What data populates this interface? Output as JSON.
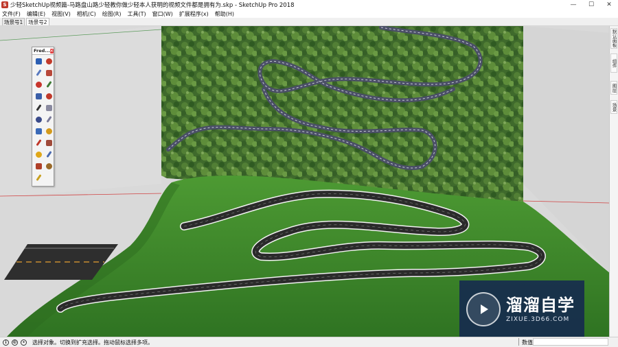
{
  "window": {
    "title": "少轻SketchUp视频篇-马路盘山路少轻教你做少轻本人获明的视频文件都是拥有为.skp - SketchUp Pro 2018",
    "app_icon": "sketchup-logo-icon",
    "controls": {
      "minimize": "—",
      "maximize": "☐",
      "close": "✕"
    }
  },
  "menu": [
    "文件(F)",
    "编辑(E)",
    "视图(V)",
    "相机(C)",
    "绘图(R)",
    "工具(T)",
    "窗口(W)",
    "扩展程序(x)",
    "帮助(H)"
  ],
  "scenes": [
    "场景号1",
    "场景号2"
  ],
  "active_scene": 1,
  "palette": {
    "title": "Fred...",
    "close": "✕",
    "tools": [
      {
        "icon": "wave-tool-icon",
        "color": "#2c5fb3"
      },
      {
        "icon": "cone-tool-icon",
        "color": "#c23a2a"
      },
      {
        "icon": "cube-tool-icon",
        "color": "#5a7abf"
      },
      {
        "icon": "prism-tool-icon",
        "color": "#b8483a"
      },
      {
        "icon": "box-red-tool-icon",
        "color": "#c8362e"
      },
      {
        "icon": "tree-tool-icon",
        "color": "#3d7a35"
      },
      {
        "icon": "split-tool-icon",
        "color": "#3b5fa8"
      },
      {
        "icon": "line-tool-icon",
        "color": "#c0392b"
      },
      {
        "icon": "pen-tool-icon",
        "color": "#333333"
      },
      {
        "icon": "fold-tool-icon",
        "color": "#8a8aa0"
      },
      {
        "icon": "bars-tool-icon",
        "color": "#3a4a8a"
      },
      {
        "icon": "swirl-tool-icon",
        "color": "#7a7a9a"
      },
      {
        "icon": "arrow-tool-icon",
        "color": "#3a6ab8"
      },
      {
        "icon": "star-tool-icon",
        "color": "#d49a1c"
      },
      {
        "icon": "slash-tool-icon",
        "color": "#c0392b"
      },
      {
        "icon": "grid-tool-icon",
        "color": "#a04a3a"
      },
      {
        "icon": "bolt-tool-icon",
        "color": "#e0a81a"
      },
      {
        "icon": "wand-tool-icon",
        "color": "#4a6ab0"
      },
      {
        "icon": "knot-tool-icon",
        "color": "#b0402a"
      },
      {
        "icon": "jar-tool-icon",
        "color": "#9a6a2a"
      },
      {
        "icon": "sprout-tool-icon",
        "color": "#c8a020"
      }
    ]
  },
  "right_tabs": [
    "默认面板",
    "组件",
    "图层",
    "场景"
  ],
  "watermark": {
    "brand": "溜溜自学",
    "site": "ZIXUE.3D66.COM",
    "logo_icon": "play-button-icon"
  },
  "status": {
    "icons": [
      "info-icon",
      "copyright-icon",
      "user-icon"
    ],
    "hint": "选择对象。切换到扩充选择。拖动鼠标选择多项。",
    "measure_label": "数值",
    "measure_value": ""
  },
  "colors": {
    "viewport_bg": "#d9d9d9",
    "grass": "#3e8a2a",
    "grass_dark": "#2f6e1f",
    "road": "#2a2a2a",
    "road_edge": "#f4f4f4",
    "forest": "#3f6a2c",
    "watermark_bg": "#14284f"
  }
}
